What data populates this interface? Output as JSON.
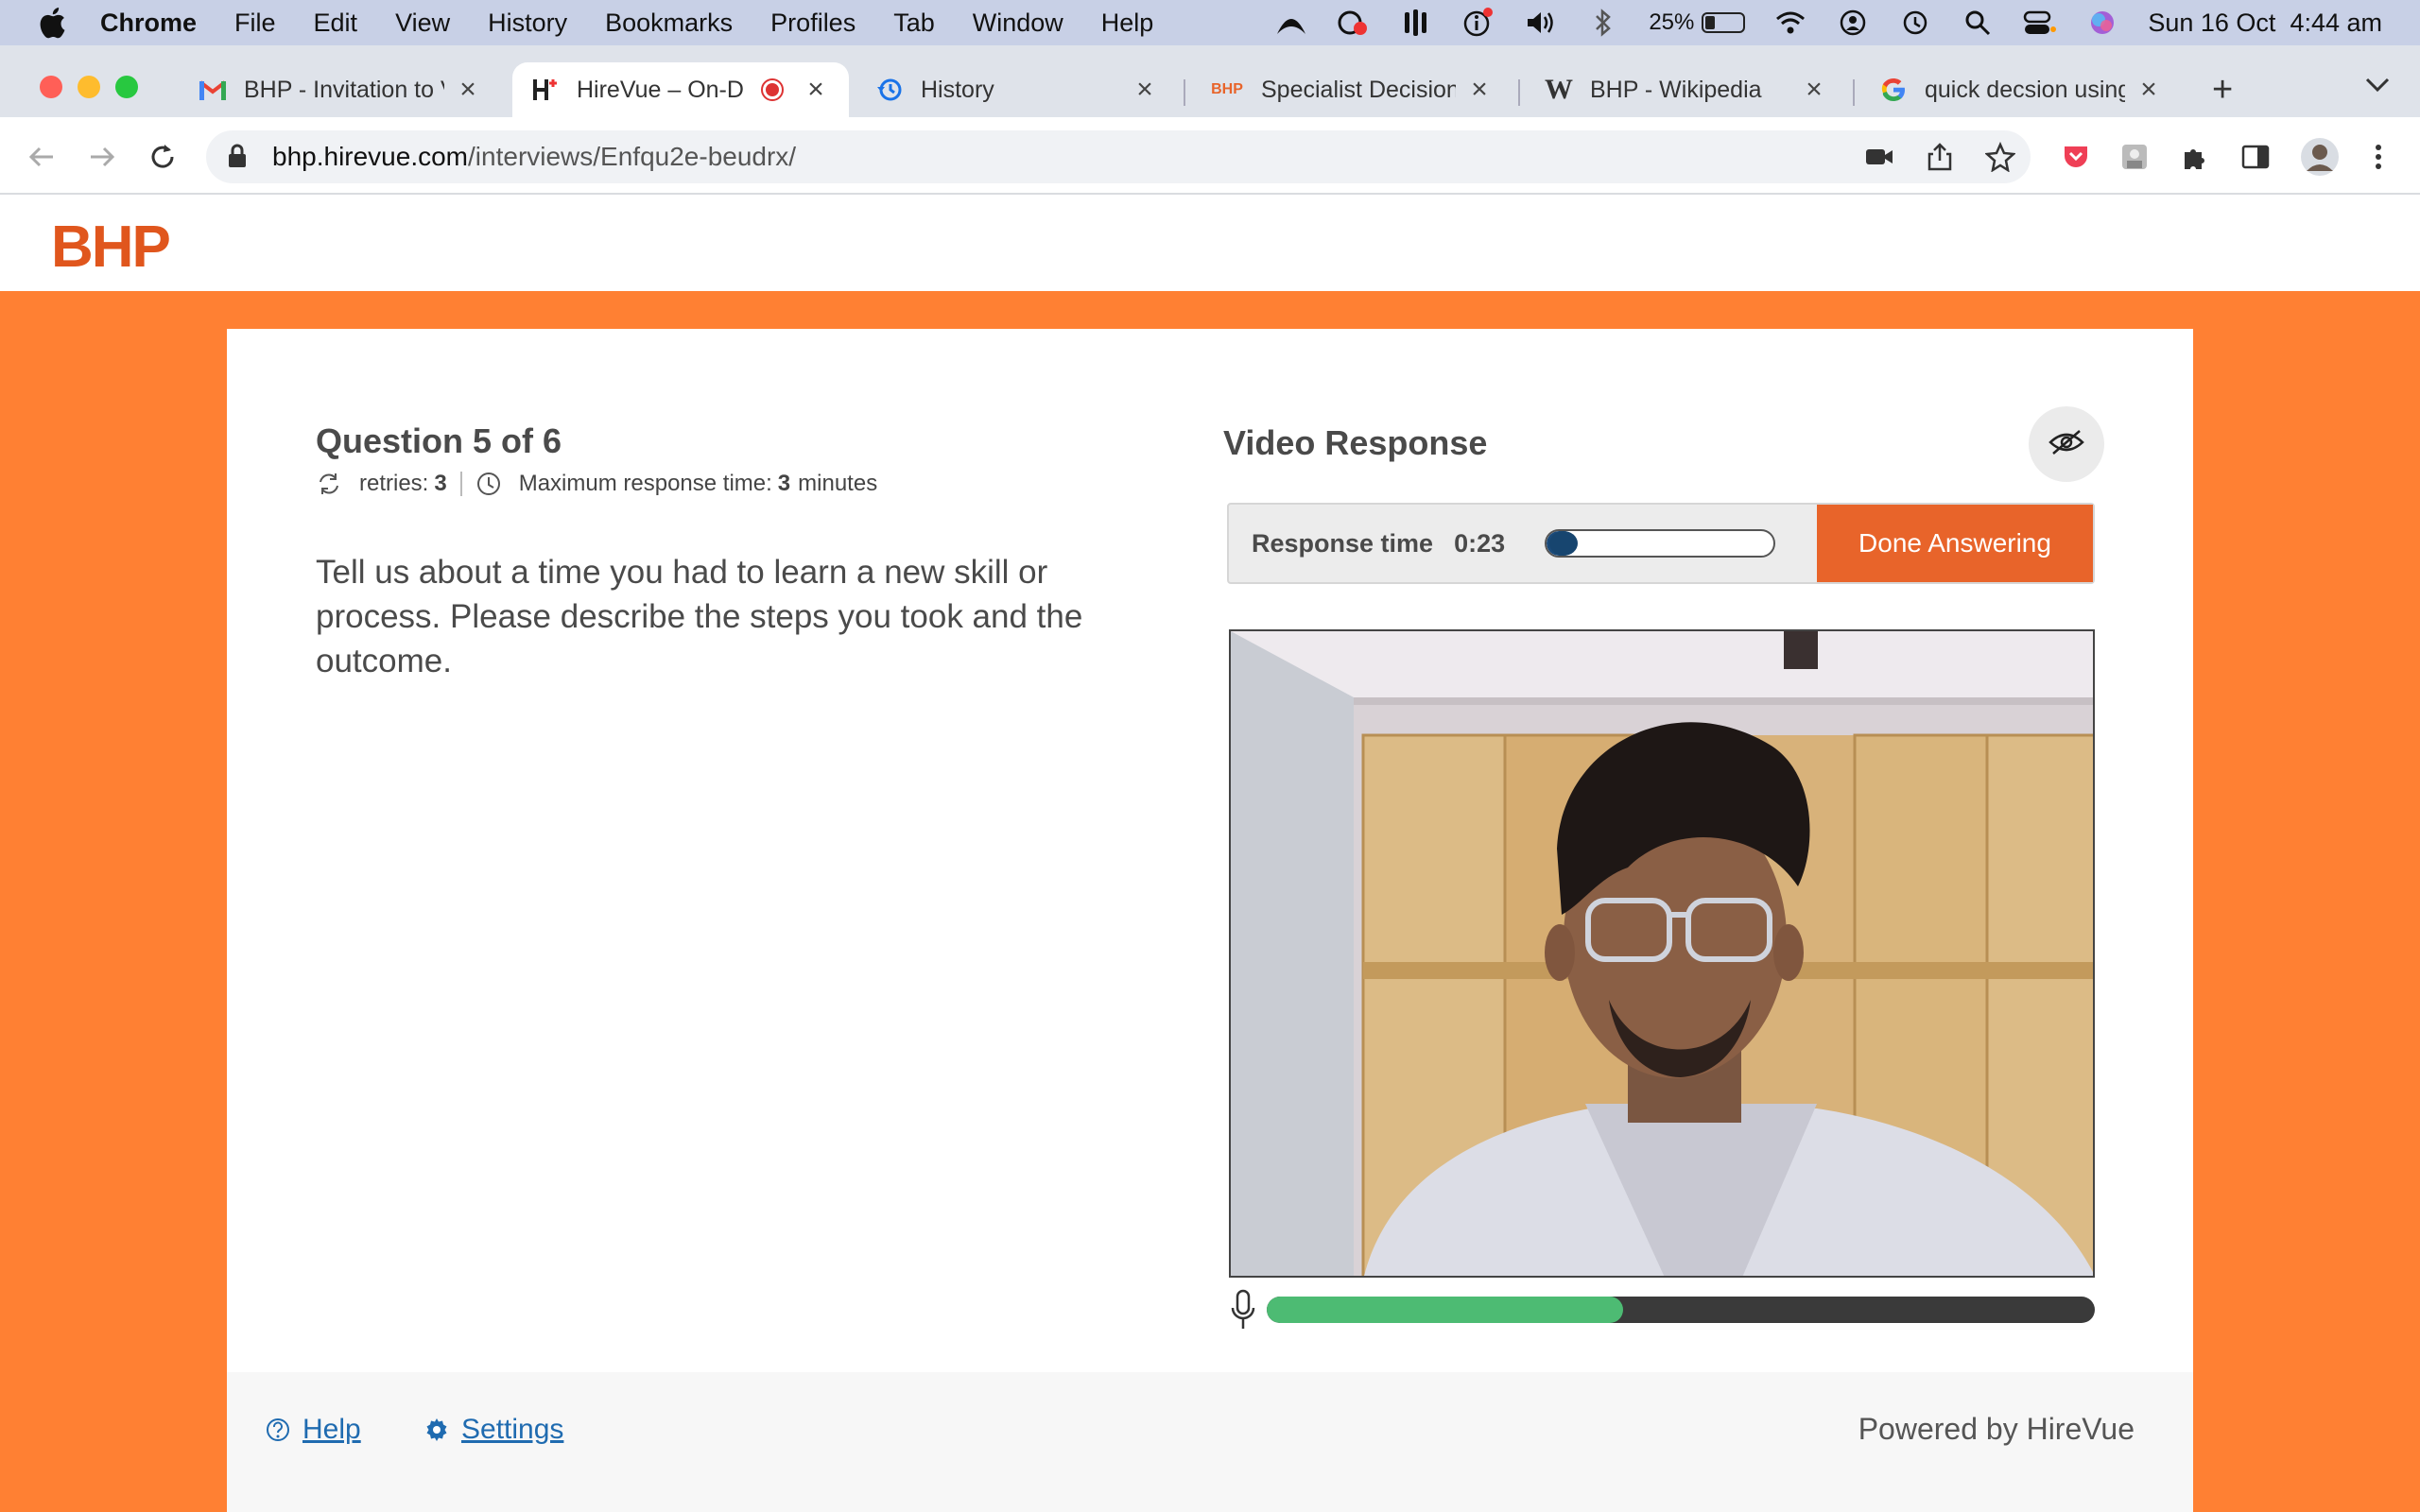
{
  "menubar": {
    "app_name": "Chrome",
    "items": [
      "File",
      "Edit",
      "View",
      "History",
      "Bookmarks",
      "Profiles",
      "Tab",
      "Window",
      "Help"
    ],
    "battery_percent": "25%",
    "battery_level": 0.25,
    "datetime": "Sun 16 Oct  4:44 am",
    "status_icons": [
      "arc-icon",
      "creative-cloud-icon",
      "bars-app-icon",
      "info-icon",
      "volume-icon",
      "bluetooth-icon",
      "battery-icon",
      "wifi-icon",
      "user-icon",
      "time-machine-icon",
      "spotlight-icon",
      "control-center-icon",
      "siri-icon"
    ]
  },
  "tabs": [
    {
      "title": "BHP - Invitation to V",
      "icon": "gmail-icon"
    },
    {
      "title": "HireVue – On-D",
      "icon": "hirevue-icon"
    },
    {
      "title": "History",
      "icon": "history-icon"
    },
    {
      "title": "Specialist Decision S",
      "icon": "bhp-favicon-icon"
    },
    {
      "title": "BHP - Wikipedia",
      "icon": "wikipedia-icon"
    },
    {
      "title": "quick decsion using",
      "icon": "google-icon"
    }
  ],
  "toolbar": {
    "url_host": "bhp.hirevue.com",
    "url_path": "/interviews/Enfqu2e-beudrx/"
  },
  "page": {
    "logo": "BHP",
    "question": {
      "title": "Question 5 of 6",
      "retries_label": "retries:",
      "retries_value": "3",
      "max_time_label": "Maximum response time:",
      "max_time_value": "3",
      "max_time_unit": "minutes",
      "text": "Tell us about a time you had to learn a new skill or process. Please describe the steps you took and the outcome."
    },
    "video": {
      "title": "Video Response",
      "response_label": "Response time",
      "response_time": "0:23",
      "response_progress": 0.13,
      "done_label": "Done Answering",
      "mic_level": 0.43
    },
    "footer": {
      "help": "Help",
      "settings": "Settings",
      "powered": "Powered by HireVue"
    }
  },
  "colors": {
    "brand_orange": "#ff8033",
    "logo_orange": "#e0561d",
    "button_orange": "#e8642a",
    "mic_green": "#4dbb73",
    "link_blue": "#1f6bb0"
  }
}
